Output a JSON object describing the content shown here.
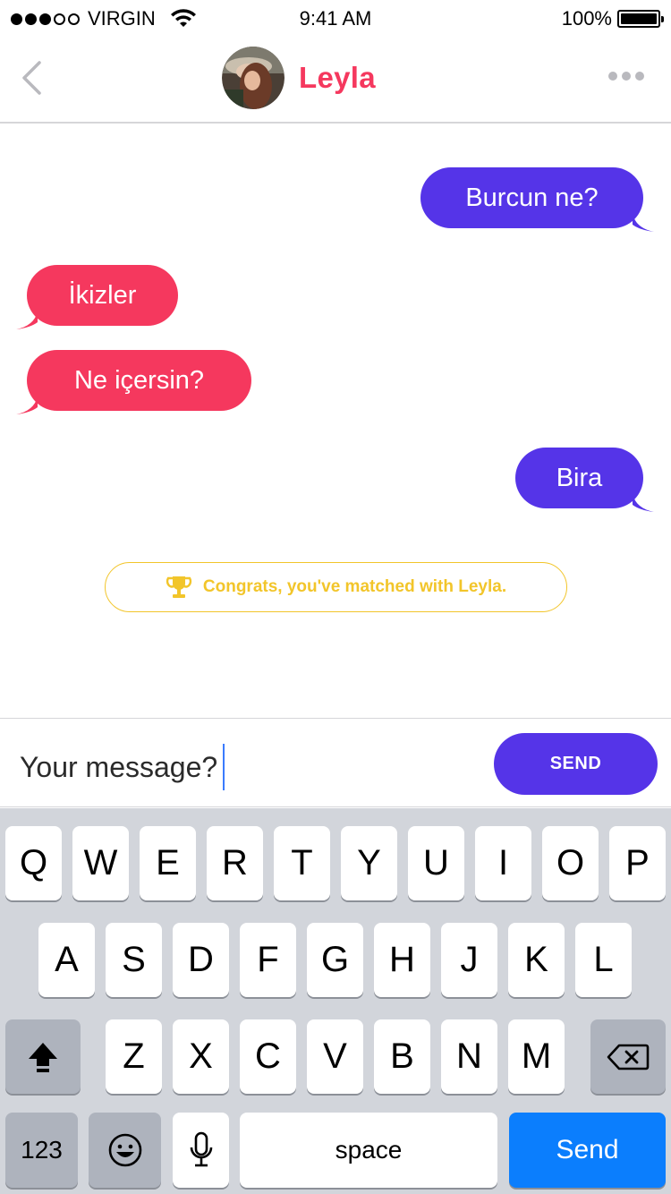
{
  "status_bar": {
    "carrier": "VIRGIN",
    "time": "9:41 AM",
    "battery": "100%",
    "signal_filled": 3,
    "signal_total": 5
  },
  "header": {
    "contact_name": "Leyla",
    "back_icon": "chevron-left-icon",
    "more_icon": "ellipsis-icon"
  },
  "messages": [
    {
      "direction": "outgoing",
      "text": "Burcun ne?"
    },
    {
      "direction": "incoming",
      "text": "İkizler"
    },
    {
      "direction": "incoming",
      "text": "Ne içersin?"
    },
    {
      "direction": "outgoing",
      "text": "Bira"
    }
  ],
  "match_notice": {
    "icon": "trophy-icon",
    "text": "Congrats, you've matched with Leyla."
  },
  "composer": {
    "value": "Your message?",
    "send_label": "SEND"
  },
  "keyboard": {
    "row1": [
      "Q",
      "W",
      "E",
      "R",
      "T",
      "Y",
      "U",
      "I",
      "O",
      "P"
    ],
    "row2": [
      "A",
      "S",
      "D",
      "F",
      "G",
      "H",
      "J",
      "K",
      "L"
    ],
    "row3": [
      "Z",
      "X",
      "C",
      "V",
      "B",
      "N",
      "M"
    ],
    "numbers_label": "123",
    "space_label": "space",
    "send_label": "Send"
  },
  "colors": {
    "accent_pink": "#f5385e",
    "accent_purple": "#5534e8",
    "match_yellow": "#f2c52a",
    "keyboard_blue": "#0b7efd"
  }
}
